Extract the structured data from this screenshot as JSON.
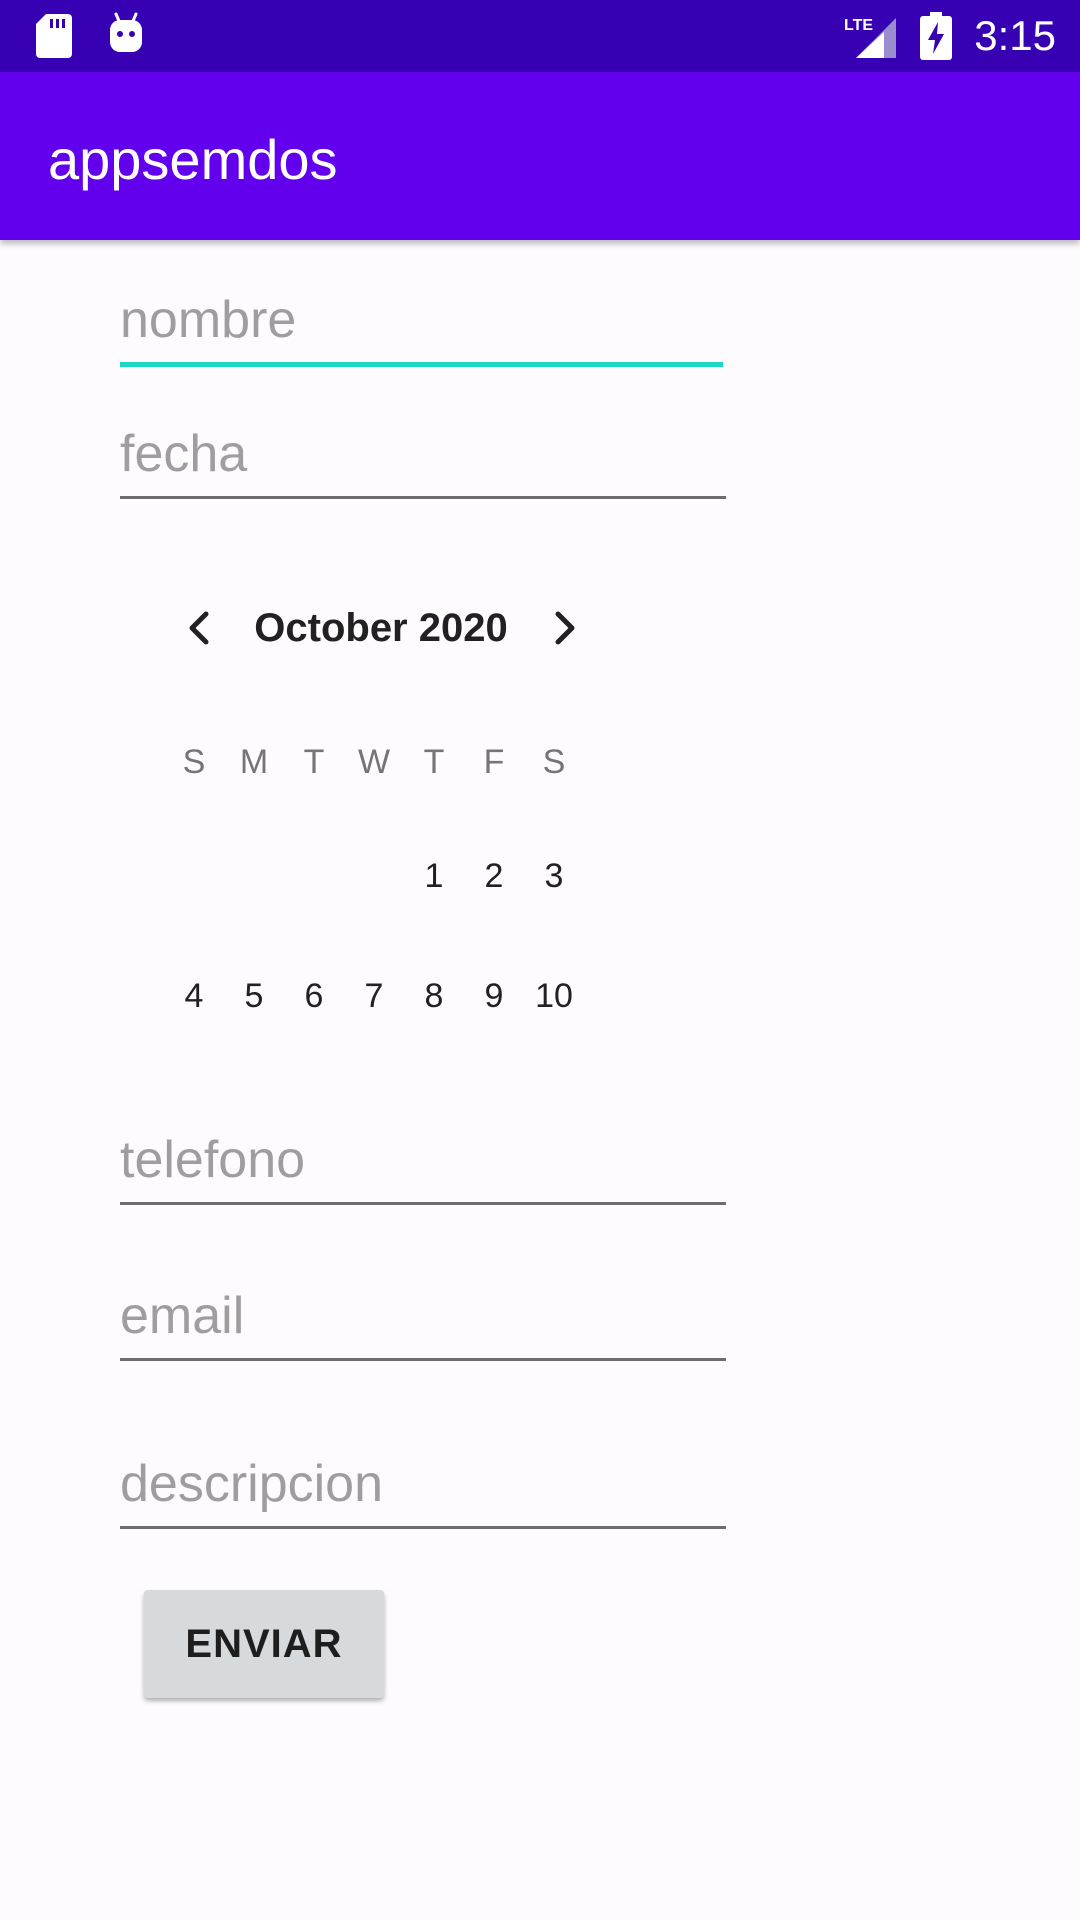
{
  "status_bar": {
    "time": "3:15",
    "network": "LTE",
    "icons": [
      "sd-card-icon",
      "android-icon",
      "signal-icon",
      "battery-charging-icon"
    ]
  },
  "app_bar": {
    "title": "appsemdos",
    "color": "#6200ee"
  },
  "form": {
    "nombre_placeholder": "nombre",
    "fecha_placeholder": "fecha",
    "telefono_placeholder": "telefono",
    "email_placeholder": "email",
    "descripcion_placeholder": "descripcion",
    "submit_label": "ENVIAR",
    "focus_color": "#1ed6c5"
  },
  "calendar": {
    "month_label": "October 2020",
    "weekdays": [
      "S",
      "M",
      "T",
      "W",
      "T",
      "F",
      "S"
    ],
    "weeks": [
      [
        "",
        "",
        "",
        "",
        "1",
        "2",
        "3"
      ],
      [
        "4",
        "5",
        "6",
        "7",
        "8",
        "9",
        "10"
      ]
    ]
  }
}
